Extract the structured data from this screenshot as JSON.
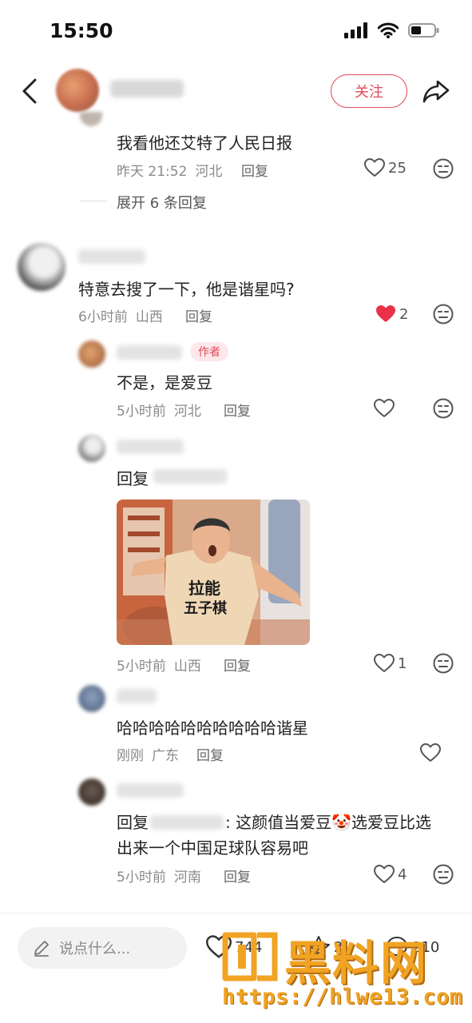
{
  "status_bar": {
    "time": "15:50"
  },
  "header": {
    "follow_label": "关注"
  },
  "comments": {
    "c0": {
      "text": "我看他还艾特了人民日报",
      "time": "昨天 21:52",
      "location": "河北",
      "reply_label": "回复",
      "likes": "25",
      "expand_label": "展开 6 条回复"
    },
    "c1": {
      "text": "特意去搜了一下，他是谐星吗?",
      "time": "6小时前",
      "location": "山西",
      "reply_label": "回复",
      "likes": "2",
      "liked": true
    },
    "r1": {
      "badge": "作者",
      "text": "不是，是爱豆",
      "time": "5小时前",
      "location": "河北",
      "reply_label": "回复"
    },
    "r2": {
      "text_prefix": "回复",
      "gif_shirt_text_1": "拉能",
      "gif_shirt_text_2": "五子棋",
      "time": "5小时前",
      "location": "山西",
      "reply_label": "回复",
      "likes": "1"
    },
    "r3": {
      "text": "哈哈哈哈哈哈哈哈哈哈谐星",
      "time": "刚刚",
      "location": "广东",
      "reply_label": "回复"
    },
    "r4": {
      "text_prefix": "回复",
      "text_line1_suffix": ": 这颜值当爱豆",
      "emoji": "🤡",
      "text_line1_end": "选爱豆比选",
      "text_line2": "出来一个中国足球队容易吧",
      "time": "5小时前",
      "location": "河南",
      "reply_label": "回复",
      "likes": "4"
    }
  },
  "bottom_bar": {
    "input_placeholder": "说点什么...",
    "likes_count": "744",
    "collect_count": "2",
    "comments_count": "210"
  },
  "watermark": {
    "title": "黑料网",
    "url": "https://hlwe13.com"
  },
  "colors": {
    "accent": "#e04a5a",
    "watermark": "#f1a323",
    "meta_gray": "#8a8a8a"
  }
}
